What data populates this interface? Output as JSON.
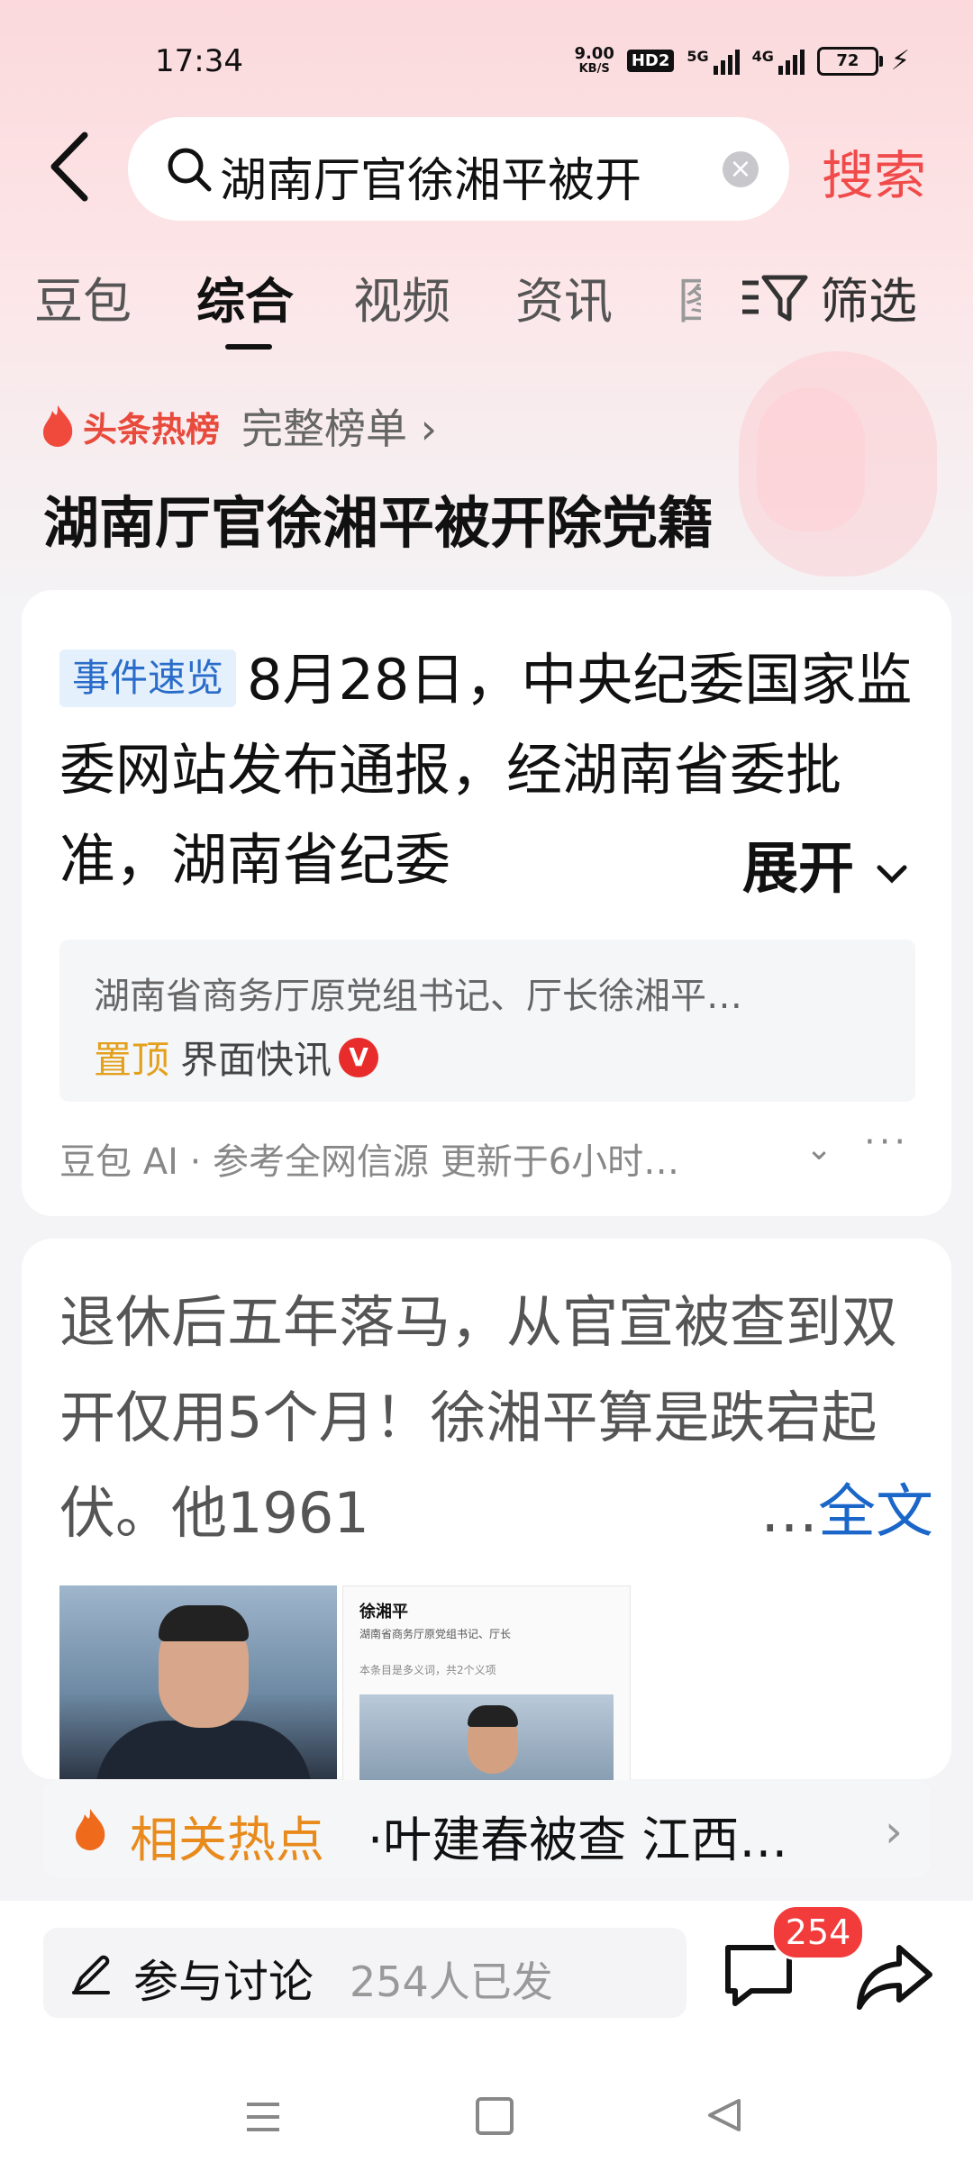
{
  "status_bar": {
    "time": "17:34",
    "speed_value": "9.00",
    "speed_unit": "KB/S",
    "hd_label": "HD2",
    "network1": "5G",
    "network2": "4G",
    "battery": "72"
  },
  "search": {
    "query": "湖南厅官徐湘平被开",
    "submit_label": "搜索"
  },
  "tabs": [
    {
      "label": "豆包"
    },
    {
      "label": "综合",
      "active": true
    },
    {
      "label": "视频"
    },
    {
      "label": "资讯"
    },
    {
      "label": "图"
    }
  ],
  "filter_label": "筛选",
  "hot_list": {
    "label": "头条热榜",
    "more_label": "完整榜单",
    "title": "湖南厅官徐湘平被开除党籍"
  },
  "summary_card": {
    "badge": "事件速览",
    "text": "8月28日，中央纪委国家监委网站发布通报，经湖南省委批准，湖南省纪委",
    "expand_label": "展开",
    "source_snippet": "湖南省商务厅原党组书记、厅长徐湘平…",
    "pinned_label": "置顶",
    "media_name": "界面快讯",
    "verified_mark": "V",
    "ai_note": "豆包 AI · 参考全网信源 更新于6小时…"
  },
  "article_card": {
    "text": "退休后五年落马，从官宣被查到双开仅用5个月！徐湘平算是跌宕起伏。他1961",
    "ellipsis": "…",
    "fulltext_label": "全文",
    "thumb_name": "徐湘平",
    "thumb_subtitle": "湖南省商务厅原党组书记、厅长",
    "thumb_note": "本条目是多义词，共2个义项"
  },
  "related": {
    "label": "相关热点",
    "text": "·叶建春被查 江西…"
  },
  "bottom_bar": {
    "discuss_label": "参与讨论",
    "discuss_count": "254人已发",
    "comment_badge": "254"
  },
  "colors": {
    "accent_red": "#f04a4a",
    "link_blue": "#1b66c9",
    "badge_blue": "#2a6cc9",
    "pin_orange": "#e3a01c"
  }
}
